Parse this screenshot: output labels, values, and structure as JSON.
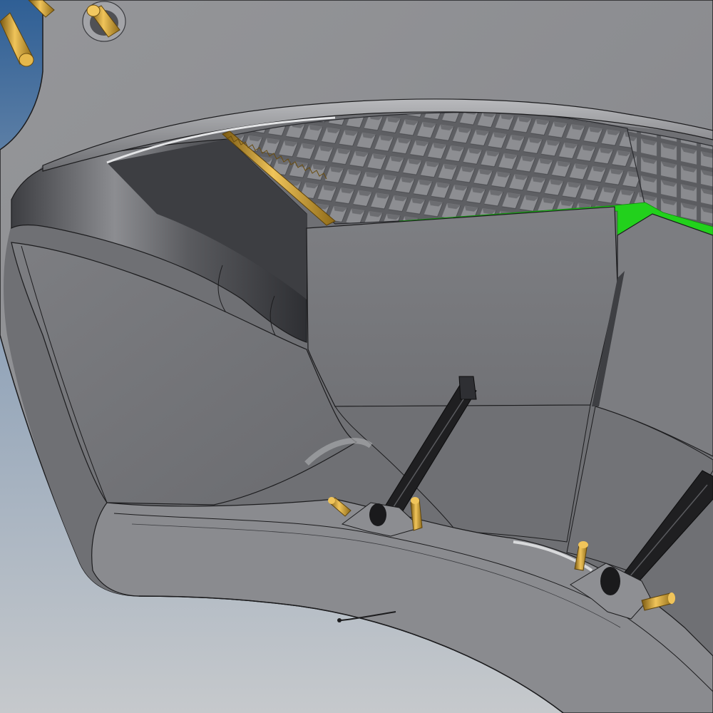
{
  "viewport": {
    "view": "3d-cad-model-render",
    "background_top": "#2f5f95",
    "background_bottom": "#c6c9cc"
  },
  "colors": {
    "casing": "#8e8f93",
    "casing_dark": "#55565a",
    "outline": "#1c1c1e",
    "grid": "#6a6b6f",
    "brass": "#c99a2e",
    "highlight_green": "#22d11c",
    "strut": "#1f1f21"
  },
  "parts": [
    "outer-casing",
    "inlet-duct",
    "honeycomb-grid-panel",
    "baffle-panel",
    "support-strut",
    "mounting-bracket",
    "brass-pin",
    "selected-face"
  ]
}
